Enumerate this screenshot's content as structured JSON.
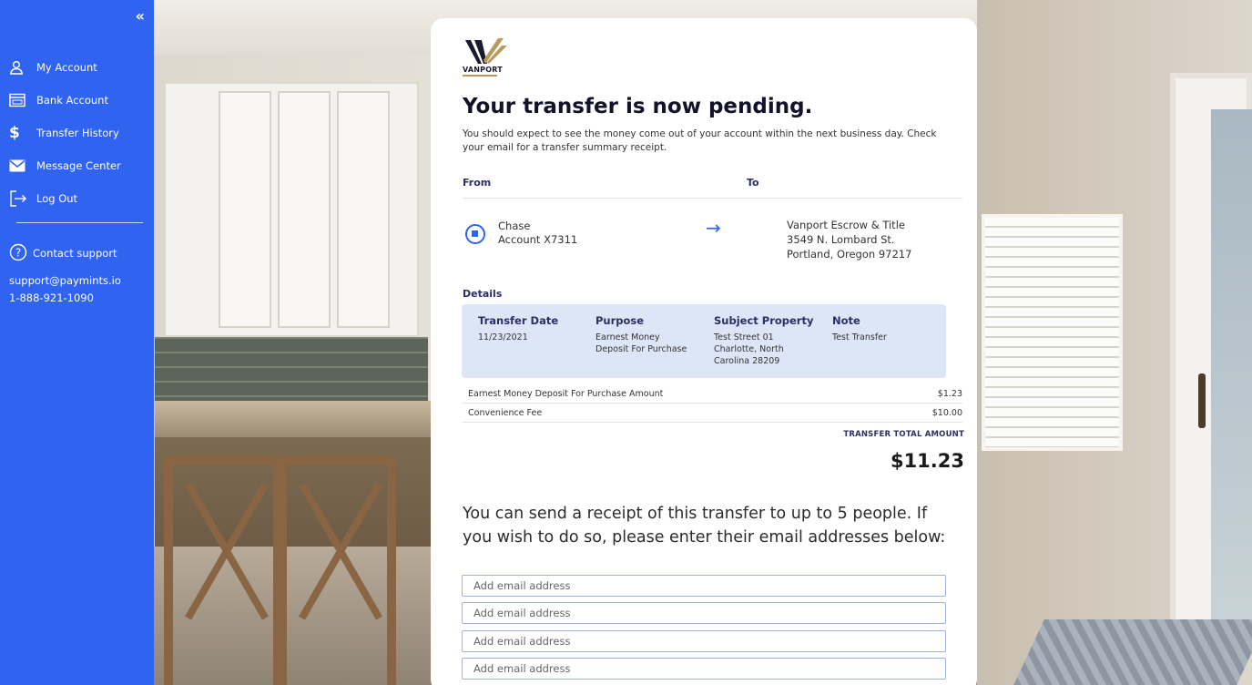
{
  "sidebar": {
    "collapse_icon": "«",
    "items": [
      {
        "label": "My Account",
        "icon": "user-icon"
      },
      {
        "label": "Bank Account",
        "icon": "bank-icon"
      },
      {
        "label": "Transfer History",
        "icon": "dollar-icon"
      },
      {
        "label": "Message Center",
        "icon": "envelope-icon"
      },
      {
        "label": "Log Out",
        "icon": "logout-icon"
      }
    ],
    "support": {
      "label": "Contact support",
      "email": "support@paymints.io",
      "phone": "1-888-921-1090"
    }
  },
  "card": {
    "logo_text": "VANPORT",
    "title": "Your transfer is now pending.",
    "subtitle": "You should expect to see the money come out of your account within the next business day. Check your email for a transfer summary receipt.",
    "from_label": "From",
    "to_label": "To",
    "from": {
      "bank": "Chase",
      "account": "Account X7311"
    },
    "to": {
      "name": "Vanport Escrow & Title",
      "address1": "3549 N. Lombard St.",
      "address2": "Portland, Oregon 97217"
    },
    "details_label": "Details",
    "details": {
      "transfer_date_label": "Transfer Date",
      "transfer_date": "11/23/2021",
      "purpose_label": "Purpose",
      "purpose_line1": "Earnest Money",
      "purpose_line2": "Deposit For Purchase",
      "property_label": "Subject Property",
      "property_line1": "Test Street 01",
      "property_line2": "Charlotte, North",
      "property_line3": "Carolina 28209",
      "note_label": "Note",
      "note": "Test Transfer"
    },
    "fees": [
      {
        "label": "Earnest Money Deposit For Purchase Amount",
        "amount": "$1.23"
      },
      {
        "label": "Convenience Fee",
        "amount": "$10.00"
      }
    ],
    "total_label": "TRANSFER TOTAL AMOUNT",
    "total_amount": "$11.23",
    "receipt_text": "You can send a receipt of this transfer to up to 5 people. If you wish to do so, please enter their email addresses below:",
    "email_placeholder": "Add email address"
  },
  "colors": {
    "sidebar_bg": "#2f63f0",
    "accent": "#2f63f0",
    "details_bg": "#dce6f7",
    "heading": "#2b2f66"
  }
}
